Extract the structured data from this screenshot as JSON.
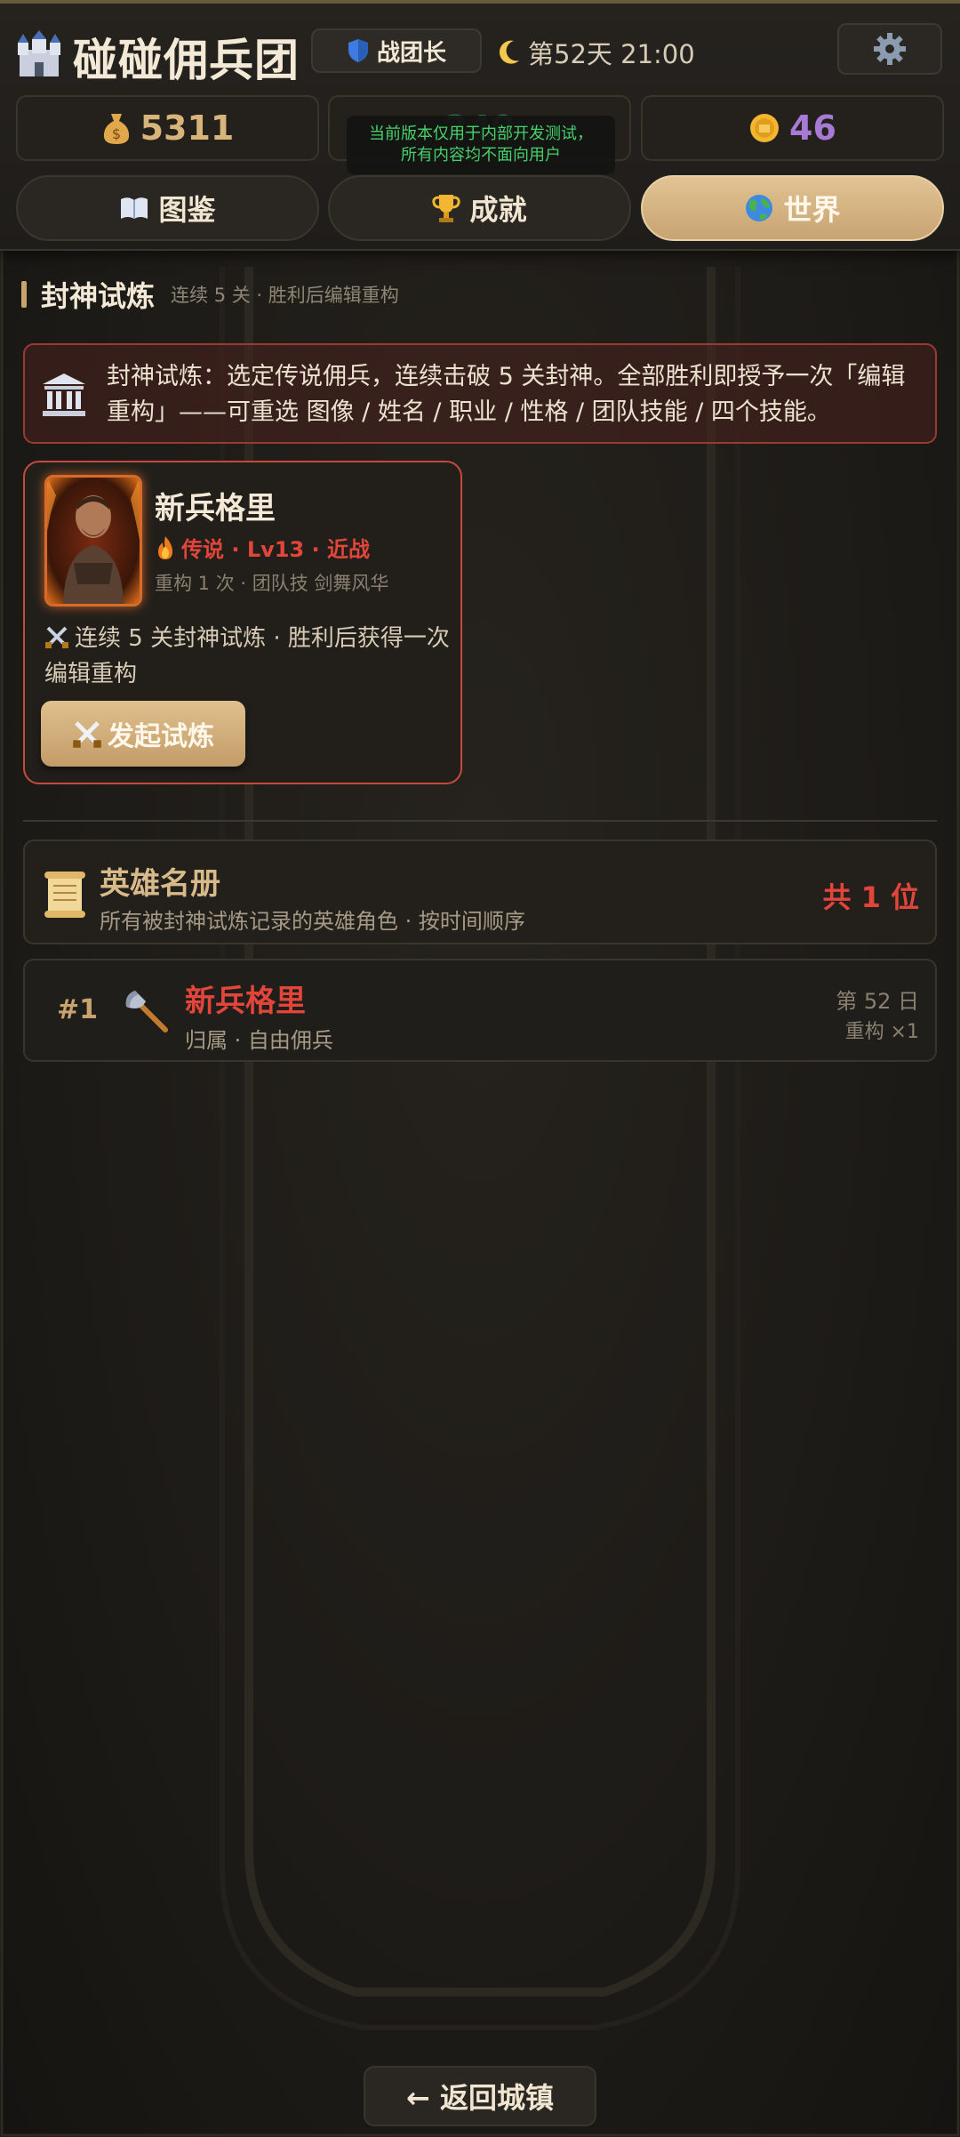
{
  "header": {
    "title": "碰碰佣兵团",
    "rank_label": "战团长",
    "day_time": "第52天 21:00",
    "resources": {
      "money": "5311",
      "middle_hidden": "240",
      "coins": "46"
    },
    "dev_notice_line1": "当前版本仅用于内部开发测试，",
    "dev_notice_line2": "所有内容均不面向用户",
    "nav": [
      {
        "label": "图鉴"
      },
      {
        "label": "成就"
      },
      {
        "label": "世界"
      }
    ]
  },
  "section": {
    "title": "封神试炼",
    "subtitle": "连续 5 关 · 胜利后编辑重构"
  },
  "info": {
    "text": "封神试炼：选定传说佣兵，连续击破 5 关封神。全部胜利即授予一次「编辑重构」——可重选 图像 / 姓名 / 职业 / 性格 / 团队技能 / 四个技能。"
  },
  "hero": {
    "name": "新兵格里",
    "meta": "传说 · Lv13 · 近战",
    "sub": "重构 1 次 · 团队技 剑舞风华",
    "desc": "连续 5 关封神试炼 · 胜利后获得一次编辑重构",
    "start_label": "发起试炼"
  },
  "roster": {
    "title": "英雄名册",
    "subtitle": "所有被封神试炼记录的英雄角色 · 按时间顺序",
    "count": "共 1 位",
    "rows": [
      {
        "rank": "#1",
        "name": "新兵格里",
        "sub": "归属 · 自由佣兵",
        "day": "第 52 日",
        "rebuild": "重构 ×1"
      }
    ]
  },
  "back_label": "← 返回城镇",
  "colors": {
    "accent_gold": "#c9a36e",
    "legend_red": "#e2453a",
    "coins_purple": "#a77ad6",
    "money_gold": "#d9b47a"
  }
}
